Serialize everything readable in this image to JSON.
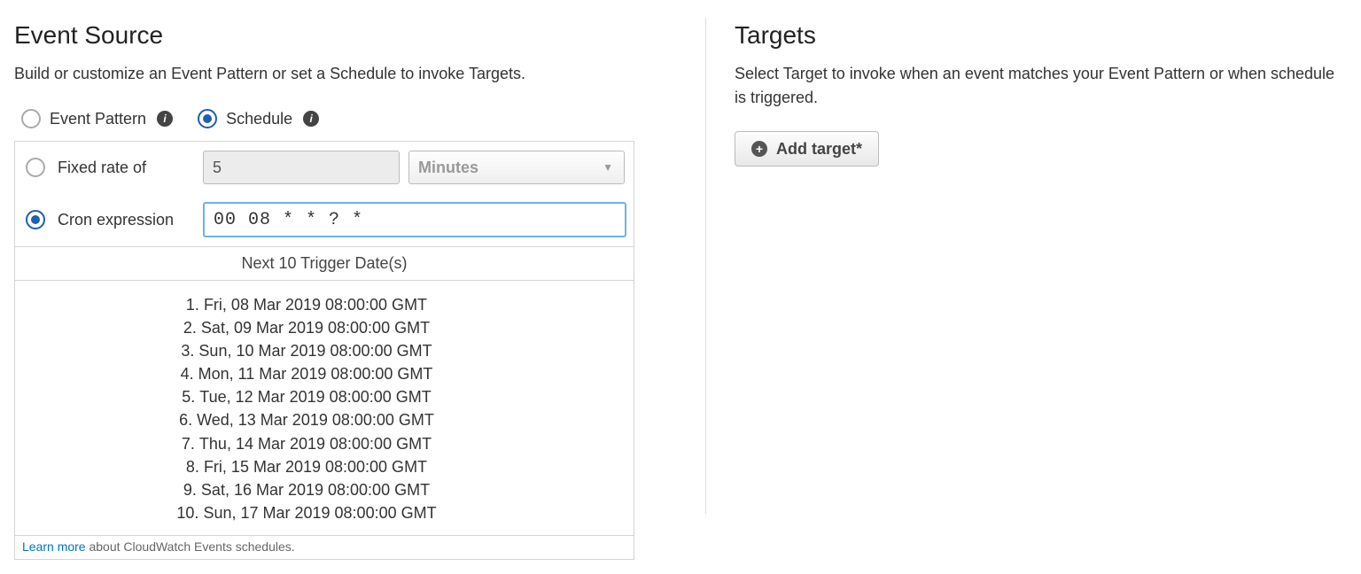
{
  "event_source": {
    "title": "Event Source",
    "description": "Build or customize an Event Pattern or set a Schedule to invoke Targets.",
    "mode_options": {
      "event_pattern_label": "Event Pattern",
      "schedule_label": "Schedule"
    },
    "schedule": {
      "fixed_rate_label": "Fixed rate of",
      "fixed_rate_value": "5",
      "fixed_rate_unit": "Minutes",
      "cron_label": "Cron expression",
      "cron_value": "00 08 * * ? *"
    },
    "triggers": {
      "header": "Next 10 Trigger Date(s)",
      "dates": [
        "Fri, 08 Mar 2019 08:00:00 GMT",
        "Sat, 09 Mar 2019 08:00:00 GMT",
        "Sun, 10 Mar 2019 08:00:00 GMT",
        "Mon, 11 Mar 2019 08:00:00 GMT",
        "Tue, 12 Mar 2019 08:00:00 GMT",
        "Wed, 13 Mar 2019 08:00:00 GMT",
        "Thu, 14 Mar 2019 08:00:00 GMT",
        "Fri, 15 Mar 2019 08:00:00 GMT",
        "Sat, 16 Mar 2019 08:00:00 GMT",
        "Sun, 17 Mar 2019 08:00:00 GMT"
      ]
    },
    "footer": {
      "link_text": "Learn more",
      "trailing_text": " about CloudWatch Events schedules."
    }
  },
  "targets": {
    "title": "Targets",
    "description": "Select Target to invoke when an event matches your Event Pattern or when schedule is triggered.",
    "add_button_label": "Add target*"
  }
}
